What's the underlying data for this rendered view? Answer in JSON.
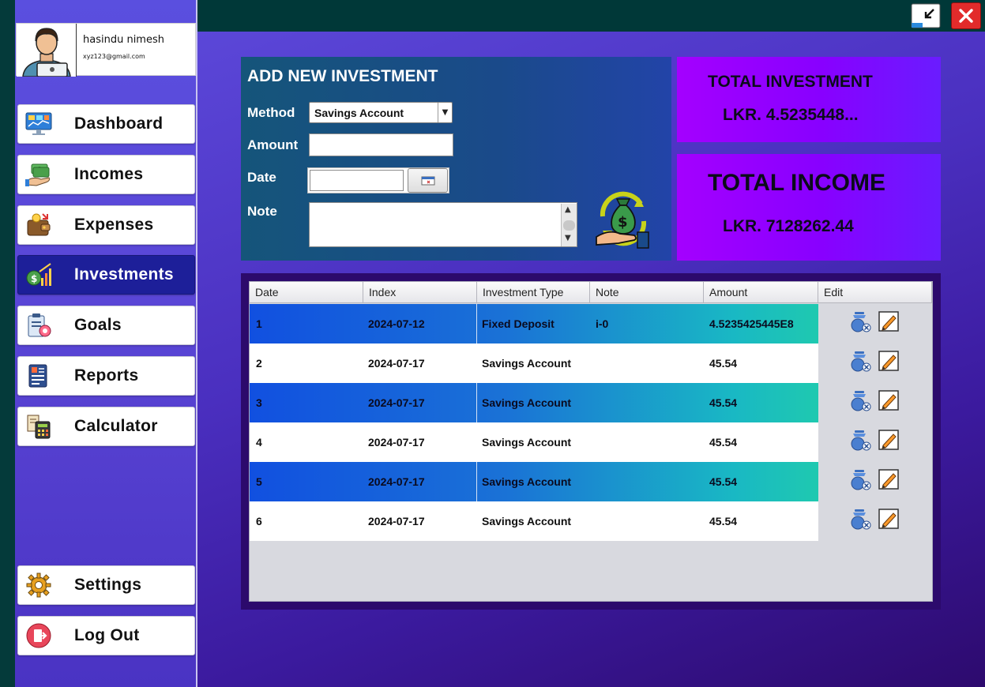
{
  "profile": {
    "name": "hasindu nimesh",
    "email": "xyz123@gmail.com"
  },
  "sidebar": {
    "items": [
      {
        "label": "Dashboard",
        "icon": "dashboard-icon",
        "active": false
      },
      {
        "label": "Incomes",
        "icon": "money-hand-icon",
        "active": false
      },
      {
        "label": "Expenses",
        "icon": "wallet-icon",
        "active": false
      },
      {
        "label": "Investments",
        "icon": "investment-growth-icon",
        "active": true
      },
      {
        "label": "Goals",
        "icon": "goal-clipboard-icon",
        "active": false
      },
      {
        "label": "Reports",
        "icon": "report-icon",
        "active": false
      },
      {
        "label": "Calculator",
        "icon": "calculator-icon",
        "active": false
      }
    ],
    "bottom_items": [
      {
        "label": "Settings",
        "icon": "gear-icon"
      },
      {
        "label": "Log Out",
        "icon": "logout-icon"
      }
    ]
  },
  "form": {
    "title": "ADD NEW INVESTMENT",
    "method_label": "Method",
    "method_value": "Savings Account",
    "amount_label": "Amount",
    "amount_value": "",
    "date_label": "Date",
    "date_value": "",
    "note_label": "Note",
    "note_value": ""
  },
  "totals": {
    "investment_label": "TOTAL INVESTMENT",
    "investment_value": "LKR. 4.5235448...",
    "income_label": "TOTAL INCOME",
    "income_value": "LKR. 7128262.44"
  },
  "table": {
    "columns": [
      "Date",
      "Index",
      "Investment Type",
      "Note",
      "Amount",
      "Edit"
    ],
    "rows": [
      {
        "c0": "1",
        "c1": "2024-07-12",
        "c2": "Fixed Deposit",
        "c3": "i-0",
        "c4": "4.5235425445E8"
      },
      {
        "c0": "2",
        "c1": "2024-07-17",
        "c2": "Savings Account",
        "c3": "",
        "c4": "45.54"
      },
      {
        "c0": "3",
        "c1": "2024-07-17",
        "c2": "Savings Account",
        "c3": "",
        "c4": "45.54"
      },
      {
        "c0": "4",
        "c1": "2024-07-17",
        "c2": "Savings Account",
        "c3": "",
        "c4": "45.54"
      },
      {
        "c0": "5",
        "c1": "2024-07-17",
        "c2": "Savings Account",
        "c3": "",
        "c4": "45.54"
      },
      {
        "c0": "6",
        "c1": "2024-07-17",
        "c2": "Savings Account",
        "c3": "",
        "c4": "45.54"
      }
    ]
  },
  "colors": {
    "active_nav": "#1d1f99",
    "total_card": "#9a00ff",
    "row_highlight": "#1150e0",
    "close_button": "#e22b2b"
  }
}
